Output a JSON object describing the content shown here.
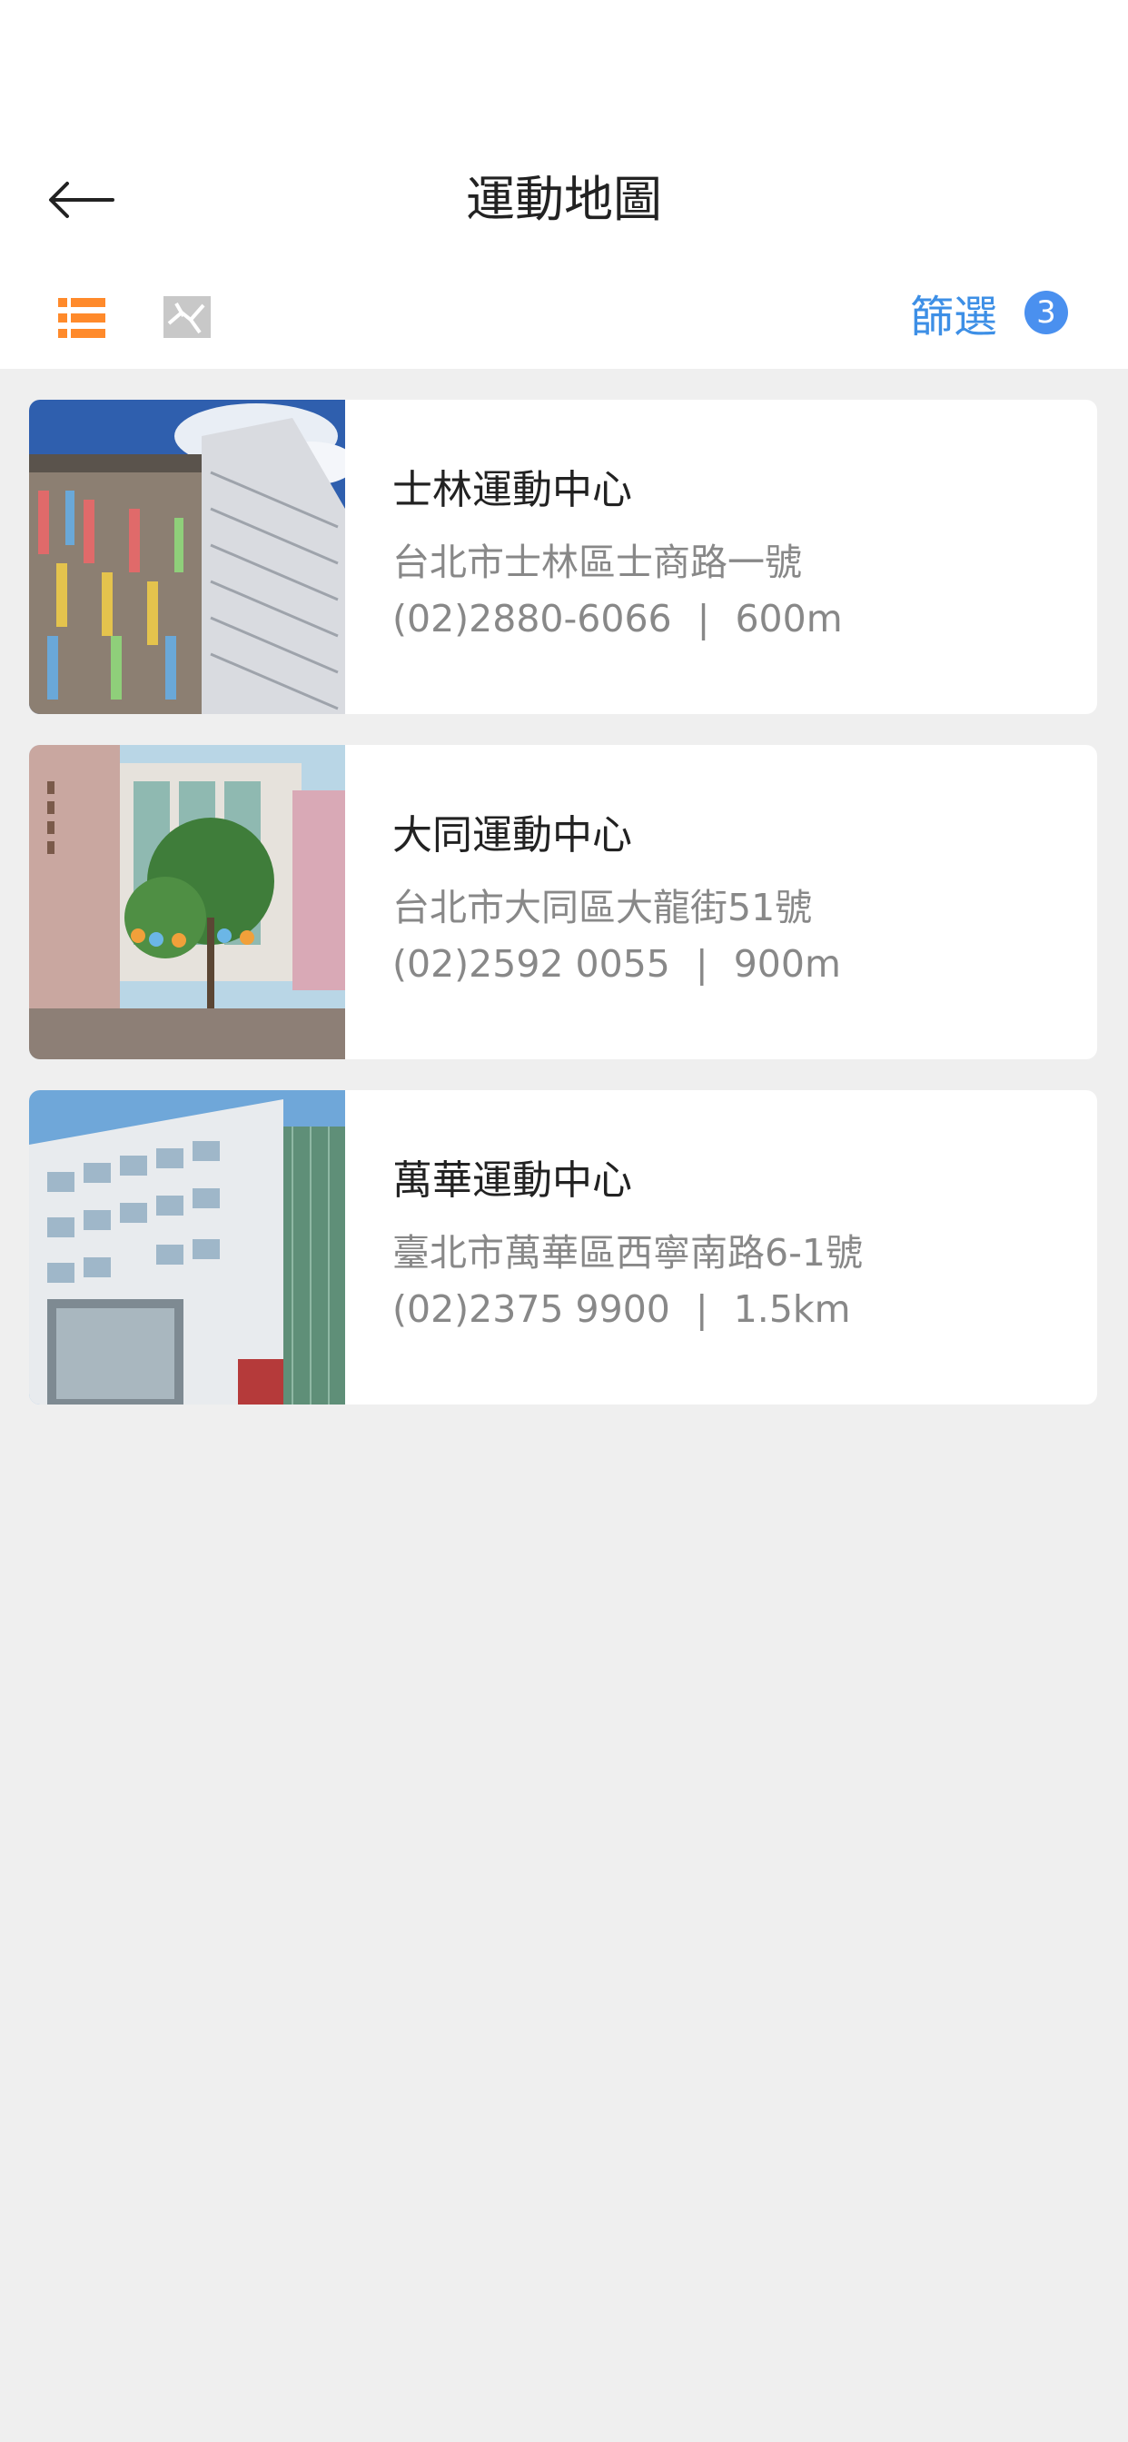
{
  "header": {
    "title": "運動地圖",
    "back_icon": "arrow-left-icon"
  },
  "toolbar": {
    "list_view_icon": "list-view-icon",
    "map_view_icon": "map-view-icon",
    "filter_label": "篩選",
    "filter_count": "3",
    "colors": {
      "active": "#ff8a2b",
      "inactive": "#c8c8c8",
      "accent": "#3d8fe6"
    }
  },
  "venues": [
    {
      "name": "士林運動中心",
      "address": "台北市士林區士商路一號",
      "phone": "(02)2880-6066",
      "separator": "|",
      "distance": "600m"
    },
    {
      "name": "大同運動中心",
      "address": "台北市大同區大龍街51號",
      "phone": "(02)2592 0055",
      "separator": "|",
      "distance": "900m"
    },
    {
      "name": "萬華運動中心",
      "address": "臺北市萬華區西寧南路6-1號",
      "phone": "(02)2375 9900",
      "separator": "|",
      "distance": "1.5km"
    }
  ]
}
